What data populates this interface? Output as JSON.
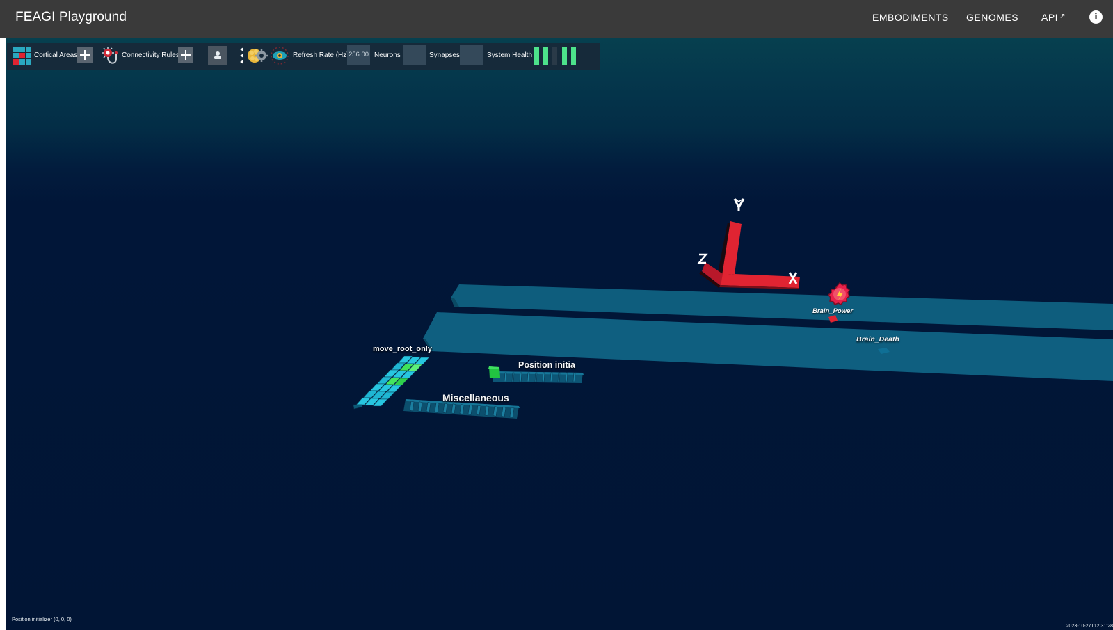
{
  "app": {
    "title": "FEAGI Playground",
    "nav": {
      "embodiments": "EMBODIMENTS",
      "genomes": "GENOMES",
      "api": "API",
      "api_arrow": "↗"
    }
  },
  "toolbar": {
    "cortical_areas_label": "Cortical Areas",
    "connectivity_rules_label": "Connectivity Rules",
    "refresh_rate_label": "Refresh Rate (Hz)",
    "refresh_rate_value": "256.00",
    "neurons_label": "Neurons",
    "neurons_value": "",
    "synapses_label": "Synapses",
    "synapses_value": "",
    "system_health_label": "System Health",
    "system_health_bars": [
      "ok",
      "ok",
      "off",
      "ok",
      "ok"
    ]
  },
  "scene": {
    "axis_labels": {
      "x": "X",
      "y": "Y",
      "z": "Z"
    },
    "areas": {
      "move_root_only": "move_root_only",
      "position_initializer": "Position initia",
      "miscellaneous": "Miscellaneous",
      "brain_power": "Brain_Power",
      "brain_death": "Brain_Death"
    }
  },
  "status": {
    "selected": "Position initializer (0, 0, 0)",
    "timestamp": "2023-10-27T12:31:28"
  },
  "colors": {
    "appbar": "#3a3a3a",
    "scene_bg": "#011535",
    "plate": "#0d5a78",
    "axis_red": "#e02432",
    "health_ok": "#4de38b",
    "active_neuron": "#22c441"
  }
}
